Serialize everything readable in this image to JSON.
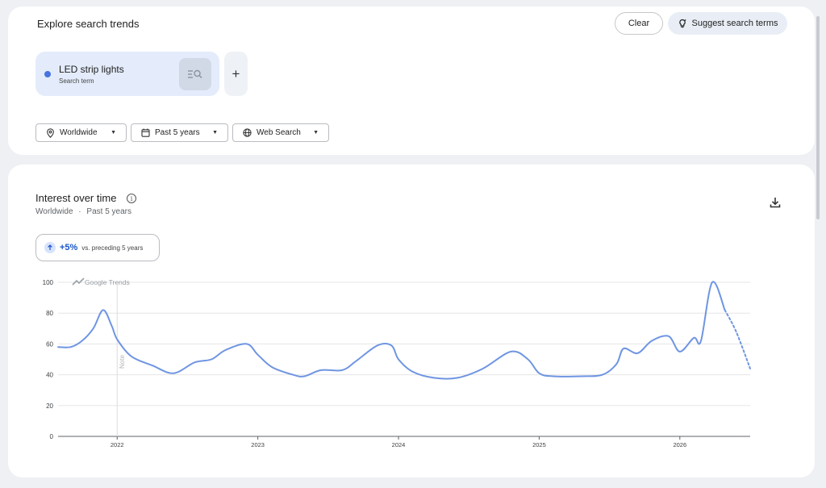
{
  "header": {
    "title": "Explore search trends",
    "clear_label": "Clear",
    "suggest_label": "Suggest search terms"
  },
  "term": {
    "name": "LED strip lights",
    "subtitle": "Search term",
    "color": "#4873e0"
  },
  "filters": {
    "geo": "Worldwide",
    "time": "Past 5 years",
    "property": "Web Search"
  },
  "interest": {
    "title": "Interest over time",
    "geo": "Worldwide",
    "separator": "·",
    "time": "Past 5 years",
    "change_value": "+5%",
    "change_label": "vs. preceding 5 years"
  },
  "chart_data": {
    "type": "line",
    "watermark": "Google Trends",
    "note_label": "Note",
    "x_ticks": [
      "2022",
      "2023",
      "2024",
      "2025",
      "2026"
    ],
    "y_ticks": [
      0,
      20,
      40,
      60,
      80,
      100
    ],
    "ylim": [
      0,
      100
    ],
    "xlim": [
      2021.58,
      2026.5
    ],
    "grid": true,
    "color": "#6f95e2",
    "series": [
      {
        "x": [
          2021.58,
          2021.67,
          2021.75,
          2021.83,
          2021.9,
          2021.96,
          2022.0,
          2022.1,
          2022.25,
          2022.4,
          2022.55,
          2022.67,
          2022.77,
          2022.92,
          2023.0,
          2023.1,
          2023.25,
          2023.33,
          2023.45,
          2023.6,
          2023.7,
          2023.85,
          2023.95,
          2024.0,
          2024.1,
          2024.25,
          2024.42,
          2024.6,
          2024.8,
          2024.92,
          2025.0,
          2025.1,
          2025.3,
          2025.45,
          2025.55,
          2025.6,
          2025.7,
          2025.8,
          2025.92,
          2026.0,
          2026.1,
          2026.15,
          2026.23,
          2026.32
        ],
        "y": [
          58,
          58,
          62,
          70,
          82,
          72,
          63,
          52,
          46,
          41,
          48,
          50,
          56,
          60,
          53,
          45,
          40,
          39,
          43,
          43,
          49,
          59,
          59,
          50,
          42,
          38,
          38,
          44,
          55,
          50,
          41,
          39,
          39,
          40,
          47,
          57,
          54,
          62,
          65,
          55,
          64,
          62,
          100,
          82
        ]
      },
      {
        "partial": true,
        "x": [
          2026.32,
          2026.4,
          2026.5
        ],
        "y": [
          82,
          68,
          44
        ]
      }
    ]
  }
}
